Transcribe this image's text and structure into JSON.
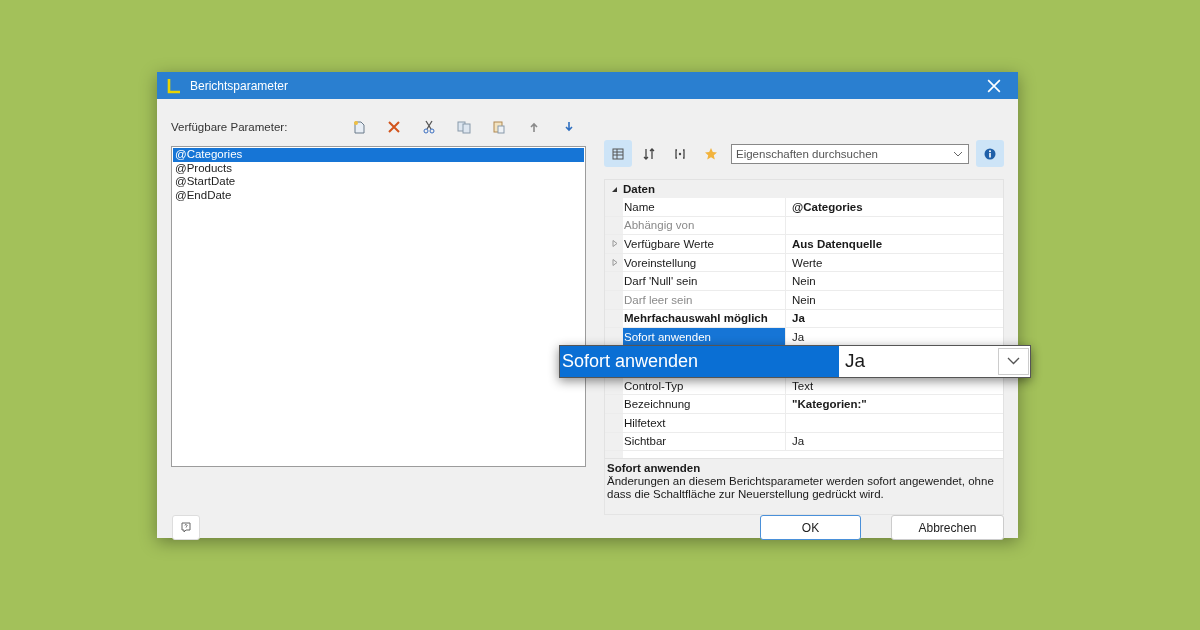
{
  "window": {
    "title": "Berichtsparameter"
  },
  "parameters": {
    "label": "Verfügbare Parameter:",
    "items": [
      {
        "text": "@Categories",
        "selected": true
      },
      {
        "text": "@Products",
        "selected": false
      },
      {
        "text": "@StartDate",
        "selected": false
      },
      {
        "text": "@EndDate",
        "selected": false
      }
    ]
  },
  "property_toolbar": {
    "view_buttons": [
      {
        "kind": "categorized",
        "selected": true
      },
      {
        "kind": "sorted",
        "selected": false
      },
      {
        "kind": "variables",
        "selected": false
      },
      {
        "kind": "favorite",
        "selected": false
      }
    ],
    "search": {
      "placeholder": "Eigenschaften durchsuchen"
    },
    "info_selected": true
  },
  "grid": {
    "category": "Daten",
    "expanded": true,
    "rows": [
      {
        "label": "Name",
        "value": "@Categories",
        "disabled": false,
        "label_bold": false,
        "value_bold": true,
        "selected": false
      },
      {
        "label": "Abhängig von",
        "disabled": true,
        "label_bold": false,
        "selected": false
      },
      {
        "label": "Verfügbare Werte",
        "value": "Aus Datenquelle",
        "disabled": false,
        "label_bold": false,
        "value_bold": true,
        "selected": false,
        "expanded": false
      },
      {
        "label": "Voreinstellung",
        "value": "Werte",
        "disabled": false,
        "label_bold": false,
        "value_bold": false,
        "selected": false,
        "expanded": false
      },
      {
        "label": "Darf 'Null' sein",
        "value": "Nein",
        "disabled": false,
        "label_bold": false,
        "value_bold": false,
        "selected": false
      },
      {
        "label": "Darf leer sein",
        "value": "Nein",
        "disabled": true,
        "label_bold": false,
        "value_bold": false,
        "selected": false
      },
      {
        "label": "Mehrfachauswahl möglich",
        "value": "Ja",
        "disabled": false,
        "label_bold": true,
        "value_bold": true,
        "selected": false
      },
      {
        "label": "Sofort anwenden",
        "value": "Ja",
        "disabled": false,
        "label_bold": false,
        "value_bold": false,
        "selected": true
      },
      {
        "kind": "zoom",
        "label": "Sofort anwenden",
        "value": "Ja"
      },
      {
        "label": "Control-Typ",
        "value": "Text",
        "disabled": false,
        "label_bold": false,
        "value_bold": false,
        "selected": false
      },
      {
        "label": "Bezeichnung",
        "value": "\"Kategorien:\"",
        "disabled": false,
        "label_bold": false,
        "value_bold": true,
        "selected": false
      },
      {
        "label": "Hilfetext",
        "disabled": false,
        "label_bold": false,
        "selected": false
      },
      {
        "label": "Sichtbar",
        "value": "Ja",
        "disabled": false,
        "label_bold": false,
        "value_bold": false,
        "selected": false
      }
    ]
  },
  "description": {
    "title": "Sofort anwenden",
    "text": "Änderungen an diesem Berichtsparameter werden sofort angewendet, ohne dass die Schaltfläche zur Neuerstellung gedrückt wird."
  },
  "buttons": [
    {
      "label": "OK",
      "default": true
    },
    {
      "label": "Abbrechen",
      "default": false
    }
  ]
}
